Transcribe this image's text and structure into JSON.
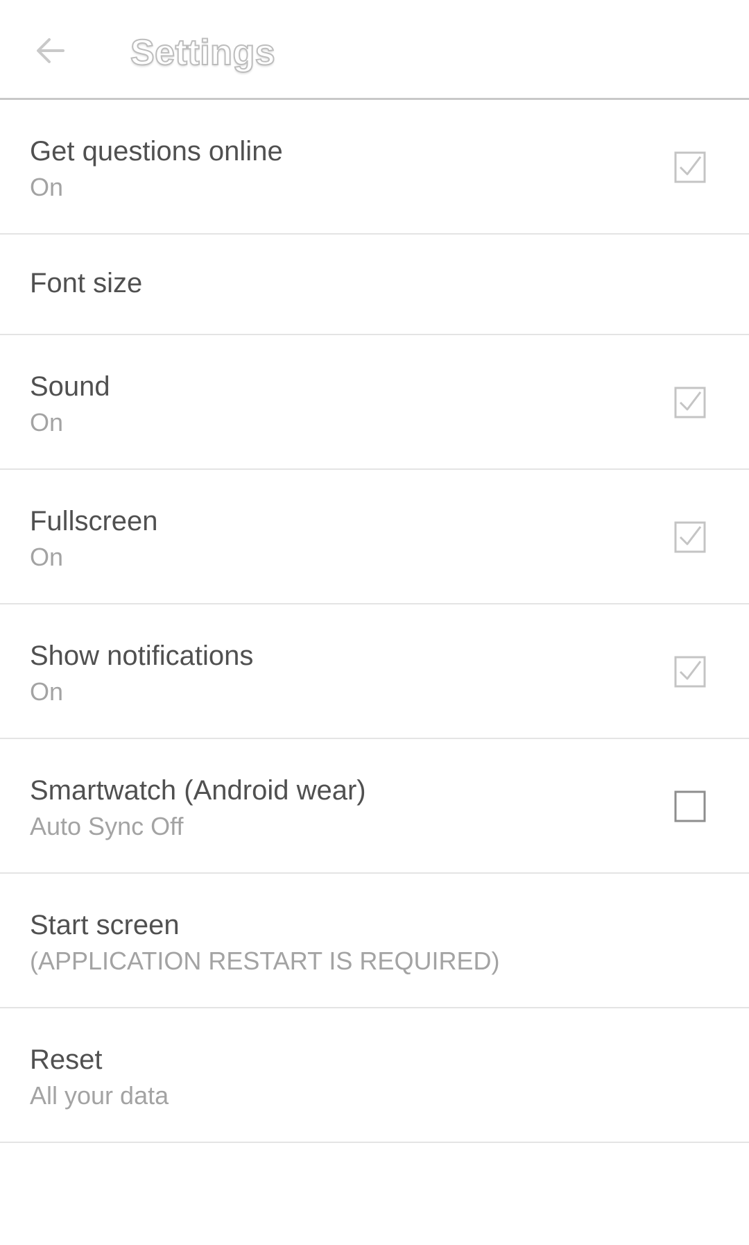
{
  "appbar": {
    "back_icon": "arrow-left-icon",
    "title": "Settings"
  },
  "colors": {
    "text_primary": "#505050",
    "text_secondary": "#a3a3a3",
    "divider": "#e4e4e4",
    "checkbox": "#c4c4c4"
  },
  "settings": [
    {
      "title": "Get questions online",
      "summary": "On",
      "checkbox": true,
      "checked": true
    },
    {
      "title": "Font size",
      "summary": "",
      "checkbox": false
    },
    {
      "title": "Sound",
      "summary": "On",
      "checkbox": true,
      "checked": true
    },
    {
      "title": "Fullscreen",
      "summary": "On",
      "checkbox": true,
      "checked": true
    },
    {
      "title": "Show notifications",
      "summary": "On",
      "checkbox": true,
      "checked": true
    },
    {
      "title": "Smartwatch (Android wear)",
      "summary": "Auto Sync Off",
      "checkbox": true,
      "checked": false
    },
    {
      "title": "Start screen",
      "summary": "(APPLICATION RESTART IS REQUIRED)",
      "checkbox": false
    },
    {
      "title": "Reset",
      "summary": "All your data",
      "checkbox": false
    }
  ]
}
